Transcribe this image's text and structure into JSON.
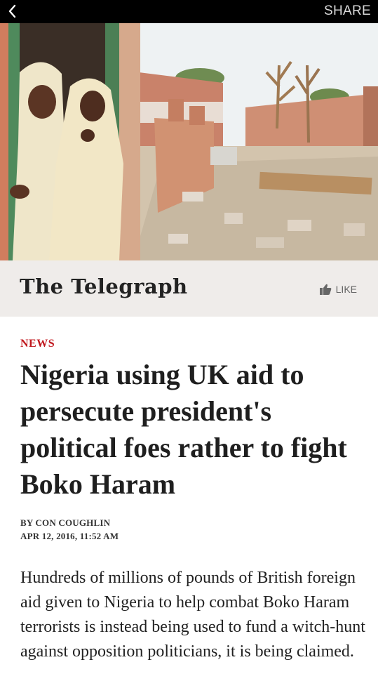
{
  "topbar": {
    "back_icon": "chevron-left-icon",
    "share_label": "SHARE"
  },
  "hero": {
    "image": "photo of two girls in white hijabs at a doorway beside rubble of a destroyed school",
    "colors": {
      "sky": "#eef2f3",
      "wall": "#d9a288",
      "rubble": "#cbbba5"
    }
  },
  "masthead": {
    "logo_text": "The Telegraph",
    "like_icon": "thumbs-up-icon",
    "like_label": "LIKE"
  },
  "article": {
    "section": "NEWS",
    "headline": "Nigeria using UK aid to persecute president's political foes rather to fight Boko Haram",
    "byline": "BY CON COUGHLIN",
    "dateline": "APR 12, 2016, 11:52 AM",
    "body": "Hundreds of millions of pounds of British foreign aid given to Nigeria to help combat Boko Haram terrorists is instead being used to fund a witch-hunt against opposition politicians, it is being claimed."
  },
  "colors": {
    "accent": "#c0171d",
    "masthead_bg": "#efecea",
    "topbar_bg": "#000000"
  }
}
